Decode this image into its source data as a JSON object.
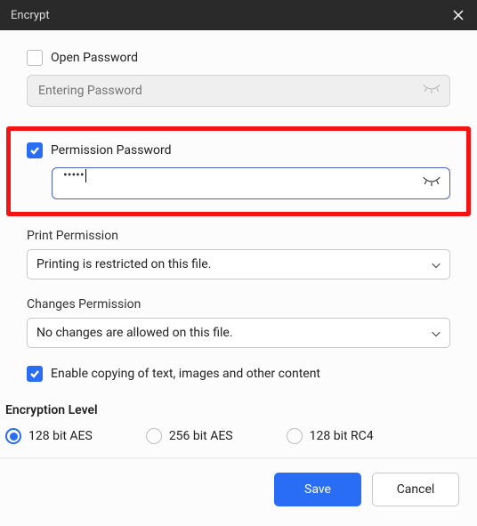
{
  "titlebar": {
    "title": "Encrypt"
  },
  "openPassword": {
    "label": "Open Password",
    "checked": false,
    "placeholder": "Entering Password",
    "value": ""
  },
  "permissionPassword": {
    "label": "Permission Password",
    "checked": true,
    "masked": "•••••"
  },
  "printPermission": {
    "label": "Print Permission",
    "selected": "Printing is restricted on this file."
  },
  "changesPermission": {
    "label": "Changes Permission",
    "selected": "No changes are allowed on this file."
  },
  "enableCopy": {
    "label": "Enable copying of text, images and other content",
    "checked": true
  },
  "encryptionLevel": {
    "title": "Encryption Level",
    "options": [
      "128 bit AES",
      "256 bit AES",
      "128 bit RC4"
    ],
    "selected": "128 bit AES"
  },
  "footer": {
    "save": "Save",
    "cancel": "Cancel"
  }
}
